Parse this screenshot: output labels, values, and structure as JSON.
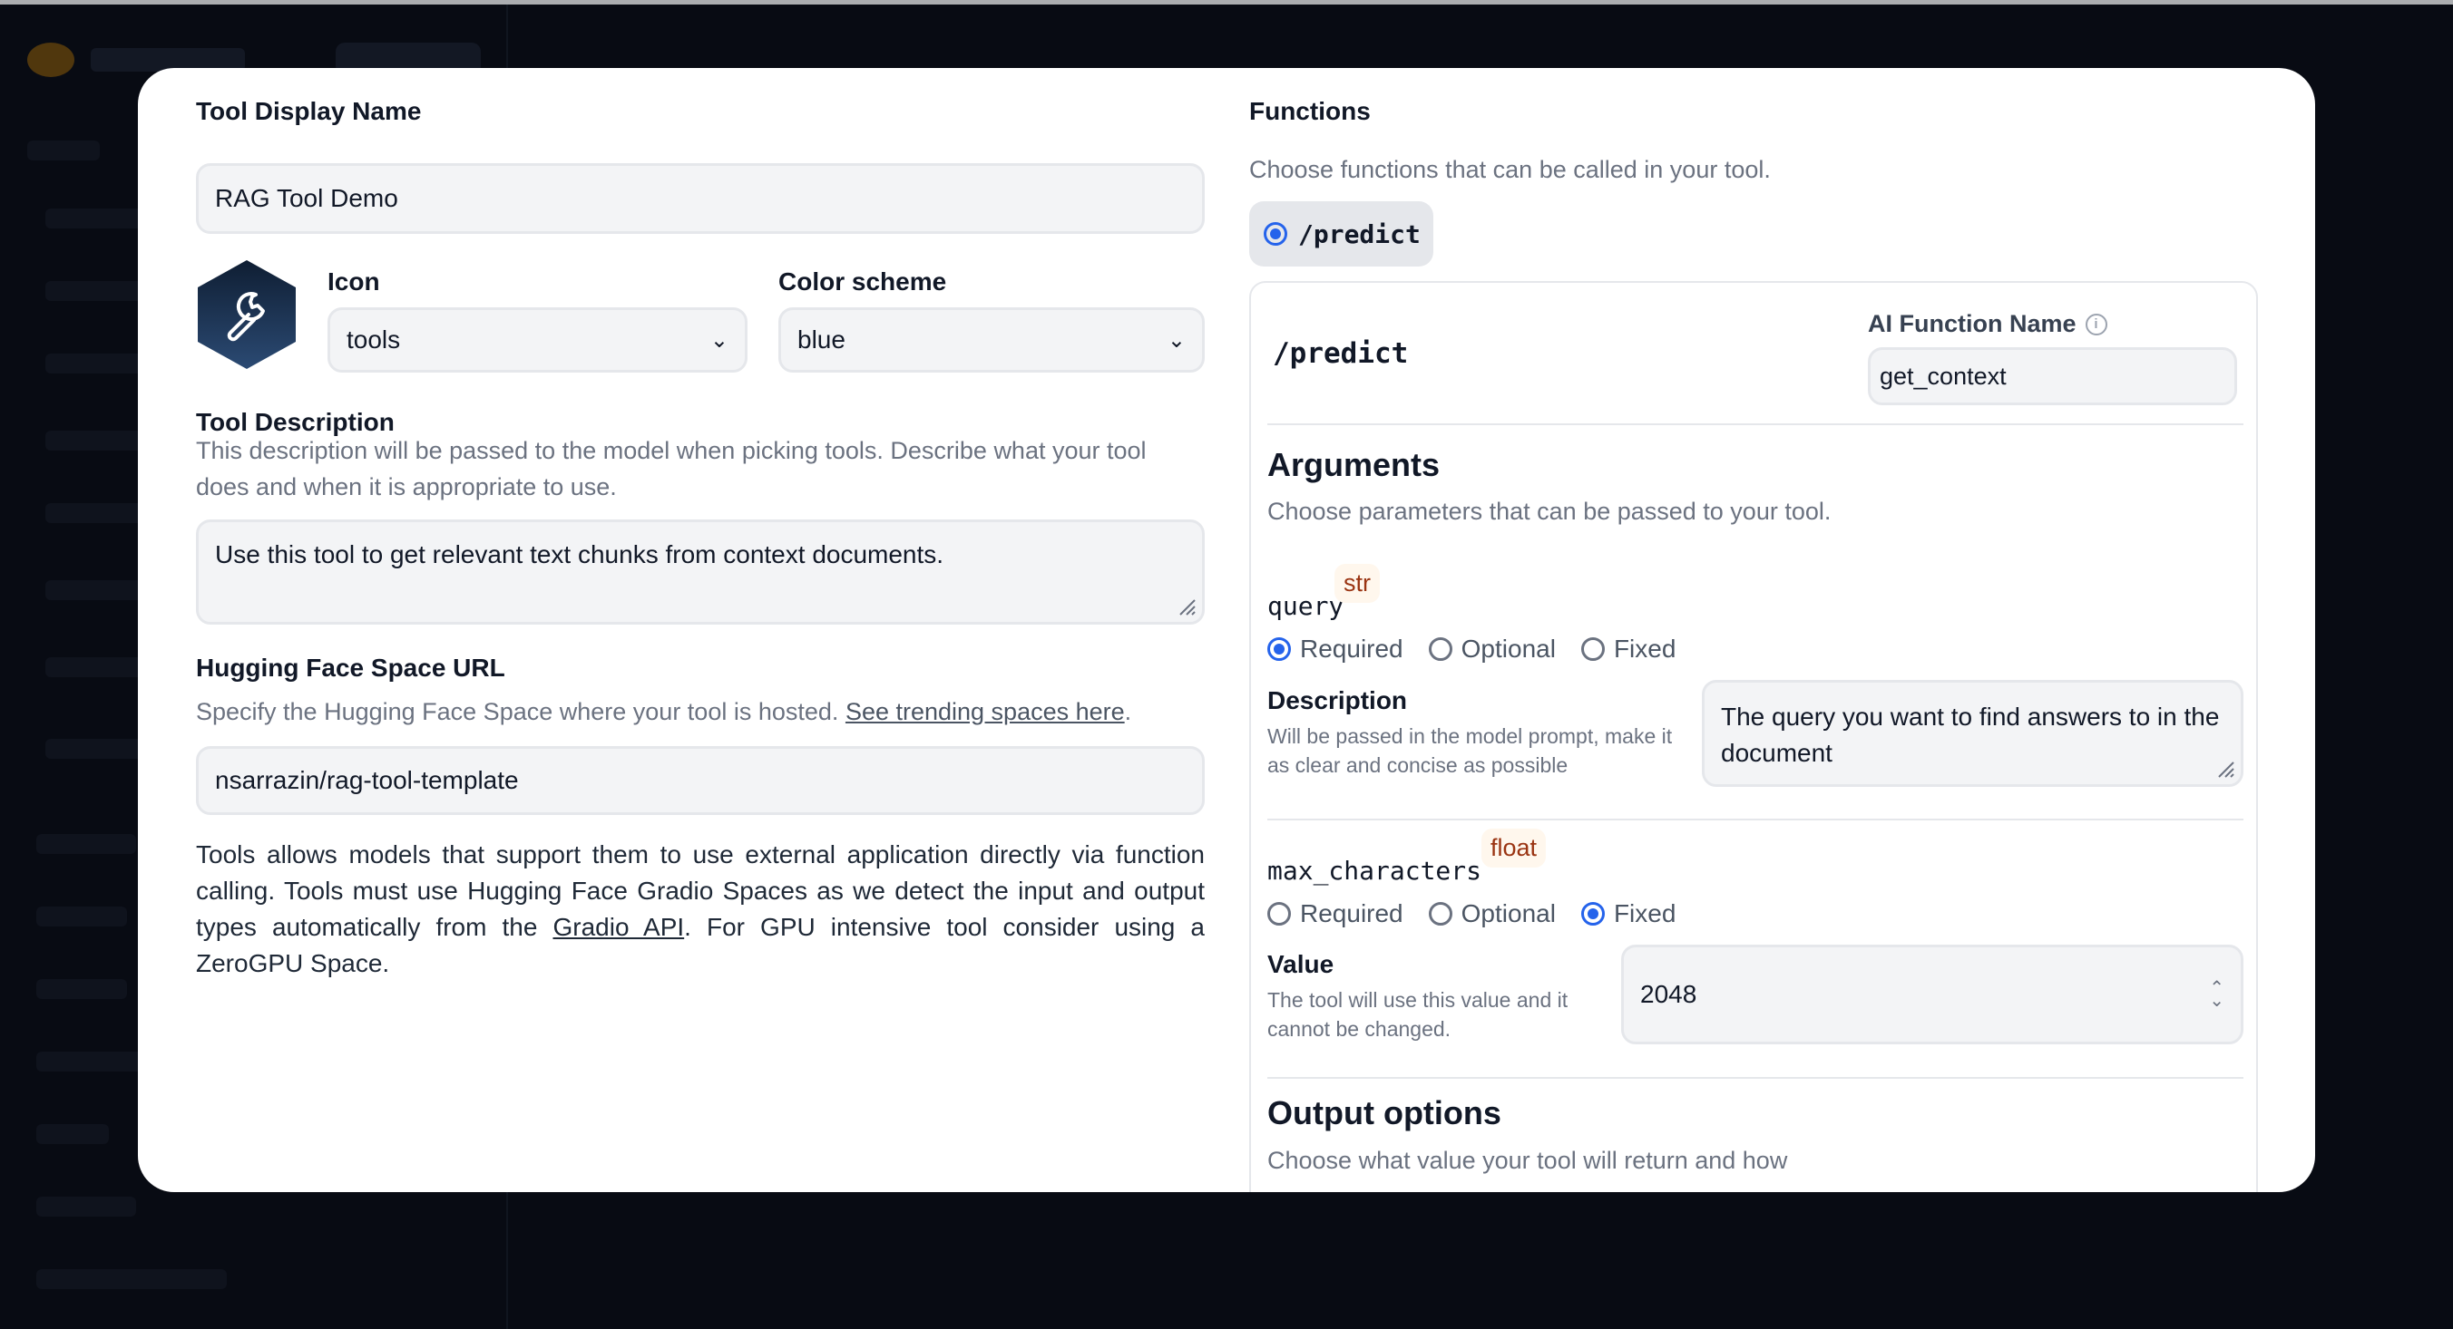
{
  "tool": {
    "display_name_label": "Tool Display Name",
    "display_name_value": "RAG Tool Demo",
    "icon_label": "Icon",
    "icon_value": "tools",
    "color_label": "Color scheme",
    "color_value": "blue",
    "description_label": "Tool Description",
    "description_hint": "This description will be passed to the model when picking tools. Describe what your tool does and when it is appropriate to use.",
    "description_value": "Use this tool to get relevant text chunks from context documents.",
    "hf_label": "Hugging Face Space URL",
    "hf_hint": "Specify the Hugging Face Space where your tool is hosted.",
    "hf_hint_link": "See trending spaces here",
    "hf_hint_end": ".",
    "hf_value": "nsarrazin/rag-tool-template",
    "para_part1": "Tools allows models that support them to use external application directly via function calling. Tools must use Hugging Face Gradio Spaces as we detect the input and output types automatically from the ",
    "para_link": "Gradio API",
    "para_part2": ". For GPU intensive tool consider using a ZeroGPU Space."
  },
  "functions": {
    "label": "Functions",
    "hint": "Choose functions that can be called in your tool.",
    "chip_label": "/predict",
    "card_title": "/predict",
    "ai_name_label": "AI Function Name",
    "ai_name_value": "get_context",
    "arguments_title": "Arguments",
    "arguments_hint": "Choose parameters that can be passed to your tool.",
    "radio_options": [
      "Required",
      "Optional",
      "Fixed"
    ],
    "params": [
      {
        "name": "query",
        "type": "str",
        "sub_label": "Description",
        "sub_hint": "Will be passed in the model prompt, make it as clear and concise as possible",
        "value": "The query you want to find answers to in the document"
      },
      {
        "name": "max_characters",
        "type": "float",
        "sub_label": "Value",
        "sub_hint": "The tool will use this value and it cannot be changed.",
        "value": "2048"
      }
    ],
    "output_title": "Output options",
    "output_hint": "Choose what value your tool will return and how"
  },
  "colors": {
    "accent": "#2563eb",
    "badge_bg": "#fff7ed",
    "icon_hex": "#1e3a5f"
  }
}
